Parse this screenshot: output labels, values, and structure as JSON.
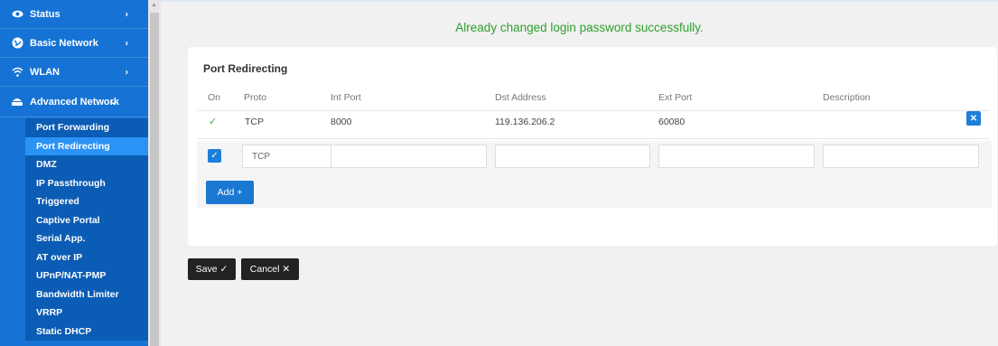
{
  "sidebar": {
    "menu": [
      {
        "label": "Status",
        "icon": "eye-icon"
      },
      {
        "label": "Basic Network",
        "icon": "globe-icon"
      },
      {
        "label": "WLAN",
        "icon": "wifi-icon"
      },
      {
        "label": "Advanced Network",
        "icon": "network-icon"
      }
    ],
    "sub_items": [
      "Port Forwarding",
      "Port Redirecting",
      "DMZ",
      "IP Passthrough",
      "Triggered",
      "Captive Portal",
      "Serial App.",
      "AT over IP",
      "UPnP/NAT-PMP",
      "Bandwidth Limiter",
      "VRRP",
      "Static DHCP"
    ],
    "active_sub": "Port Redirecting"
  },
  "notice": "Already changed login password successfully.",
  "panel": {
    "title": "Port Redirecting",
    "headers": [
      "On",
      "Proto",
      "Int Port",
      "Dst Address",
      "Ext Port",
      "Description"
    ],
    "rows": [
      {
        "on": "✓",
        "proto": "TCP",
        "int_port": "8000",
        "dst_address": "119.136.206.2",
        "ext_port": "60080",
        "description": ""
      }
    ],
    "new_row": {
      "proto_selected": "TCP",
      "int_port": "",
      "dst_address": "",
      "ext_port": "",
      "description": ""
    },
    "add_label": "Add +"
  },
  "actions": {
    "save_label": "Save ✓",
    "cancel_label": "Cancel ✕"
  },
  "colors": {
    "sidebar": "#1673d5",
    "active_sub": "#2b93f5",
    "success_text": "#2ea02e",
    "primary_button": "#1a77d2"
  }
}
